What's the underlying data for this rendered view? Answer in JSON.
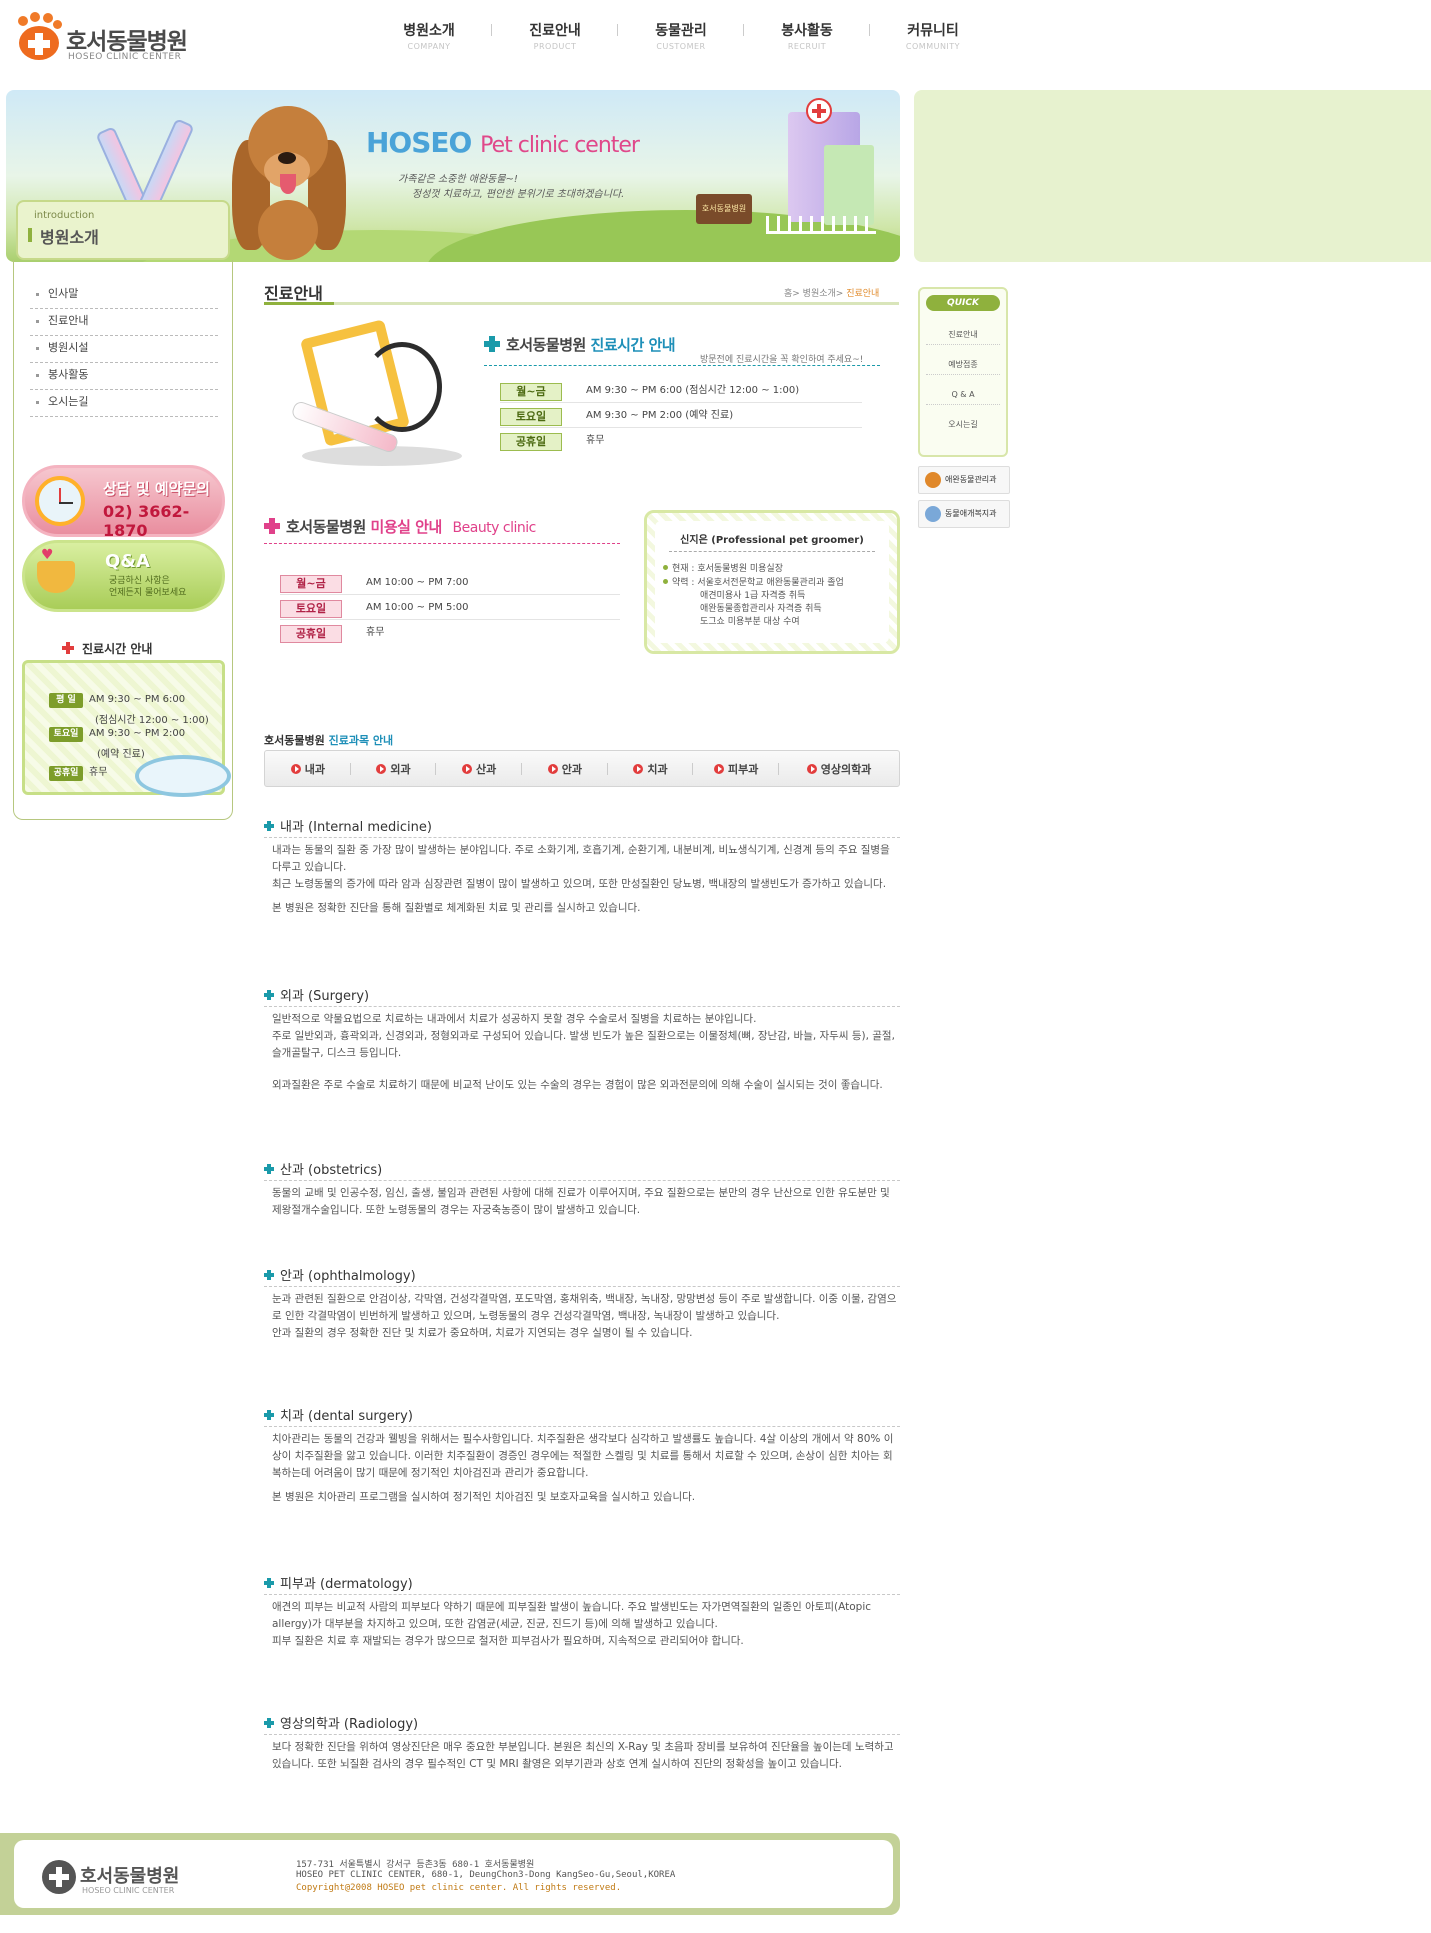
{
  "header": {
    "logo_name": "호서동물병원",
    "logo_sub": "HOSEO CLINIC CENTER",
    "nav": [
      {
        "ko": "병원소개",
        "en": "COMPANY"
      },
      {
        "ko": "진료안내",
        "en": "PRODUCT"
      },
      {
        "ko": "동물관리",
        "en": "CUSTOMER"
      },
      {
        "ko": "봉사활동",
        "en": "RECRUIT"
      },
      {
        "ko": "커뮤니티",
        "en": "COMMUNITY"
      }
    ]
  },
  "banner": {
    "title_a": "HOSEO",
    "title_b": "Pet clinic center",
    "copy1": "가족같은 소중한 애완동물~!",
    "copy2": "정성껏 치료하고, 편안한 분위기로 초대하겠습니다.",
    "sign": "호서동물병원"
  },
  "sidebar": {
    "title_en": "introduction",
    "title_ko": "병원소개",
    "items": [
      "인사말",
      "진료안내",
      "병원시설",
      "봉사활동",
      "오시는길"
    ],
    "counsel_title": "상담 및 예약문의",
    "counsel_phone": "02) 3662-1870",
    "qa_title": "Q&A",
    "qa_sub1": "궁금하신 사항은",
    "qa_sub2": "언제든지 물어보세요",
    "hours_title": "진료시간 안내",
    "hours": [
      {
        "tag": "평 일",
        "text": "AM 9:30 ~ PM 6:00",
        "sub": "(점심시간 12:00 ~ 1:00)"
      },
      {
        "tag": "토요일",
        "text": "AM 9:30 ~ PM 2:00",
        "sub": "(예약 진료)"
      },
      {
        "tag": "공휴일",
        "text": "휴무",
        "sub": ""
      }
    ]
  },
  "main": {
    "page_title": "진료안내",
    "breadcrumb_a": "홈> 병원소개> ",
    "breadcrumb_cur": "진료안내",
    "clinic_hours": {
      "title_a": "호서동물병원",
      "title_b": "진료시간 안내",
      "note": "방문전에 진료시간을 꼭 확인하여 주세요~!",
      "rows": [
        {
          "tag": "월~금",
          "value": "AM 9:30 ~ PM 6:00 (점심시간 12:00 ~ 1:00)"
        },
        {
          "tag": "토요일",
          "value": "AM 9:30 ~ PM 2:00 (예약 진료)"
        },
        {
          "tag": "공휴일",
          "value": "휴무"
        }
      ]
    },
    "beauty": {
      "title_a": "호서동물병원",
      "title_b": "미용실 안내",
      "title_c": "Beauty clinic",
      "rows": [
        {
          "tag": "월~금",
          "value": "AM 10:00 ~ PM 7:00"
        },
        {
          "tag": "토요일",
          "value": "AM 10:00 ~ PM 5:00"
        },
        {
          "tag": "공휴일",
          "value": "휴무"
        }
      ]
    },
    "groomer": {
      "name": "신지은 (Professional pet groomer)",
      "current": "현재 : 호서동물병원 미용실장",
      "career1": "약력 : 서울호서전문학교 애완동물관리과 졸업",
      "career2": "애견미용사 1급 자격증 취득",
      "career3": "애완동물종합관리사 자격증 취득",
      "career4": "도그쇼 미용부분 대상 수여"
    },
    "dept_title_a": "호서동물병원",
    "dept_title_b": "진료과목 안내",
    "dept_tabs": [
      "내과",
      "외과",
      "산과",
      "안과",
      "치과",
      "피부과",
      "영상의학과"
    ],
    "departments": [
      {
        "title": "내과 (Internal medicine)",
        "paragraphs": [
          "내과는 동물의 질환 중 가장 많이 발생하는 분야입니다. 주로 소화기계, 호흡기계, 순환기계, 내분비계, 비뇨생식기계, 신경계 등의 주요 질병을 다루고 있습니다.",
          "최근 노령동물의 증가에 따라 암과 심장관련 질병이 많이 발생하고 있으며, 또한 만성질환인 당뇨병, 백내장의 발생빈도가 증가하고 있습니다.",
          "본 병원은 정확한 진단을 통해 질환별로 체계화된 치료 및 관리를 실시하고 있습니다."
        ]
      },
      {
        "title": "외과 (Surgery)",
        "paragraphs": [
          "일반적으로 약물요법으로 치료하는 내과에서 치료가 성공하지 못할 경우 수술로서 질병을 치료하는 분야입니다.",
          "주로 일반외과, 흉곽외과, 신경외과, 정형외과로 구성되어 있습니다. 발생 빈도가 높은 질환으로는 이물정체(뼈, 장난감, 바늘, 자두씨 등), 골절, 슬개골탈구, 디스크 등입니다.",
          "외과질환은 주로 수술로 치료하기 때문에 비교적 난이도 있는 수술의 경우는 경험이 많은 외과전문의에 의해 수술이 실시되는 것이 좋습니다."
        ]
      },
      {
        "title": "산과 (obstetrics)",
        "paragraphs": [
          "동물의 교배 및 인공수정, 임신, 출생, 불임과 관련된 사항에 대해 진료가 이루어지며, 주요 질환으로는 분만의 경우 난산으로 인한 유도분만 및 제왕절개수술입니다. 또한 노령동물의 경우는 자궁축농증이 많이 발생하고 있습니다."
        ]
      },
      {
        "title": "안과 (ophthalmology)",
        "paragraphs": [
          "눈과 관련된 질환으로 안검이상, 각막염, 건성각결막염, 포도막염, 홍채위축, 백내장, 녹내장, 망망변성 등이 주로 발생합니다. 이중 이물, 감염으로 인한 각결막염이 빈번하게 발생하고 있으며, 노령동물의 경우 건성각결막염, 백내장, 녹내장이 발생하고 있습니다.",
          "안과 질환의 경우 정확한 진단 및 치료가 중요하며, 치료가 지연되는 경우 실명이 될 수 있습니다."
        ]
      },
      {
        "title": "치과 (dental surgery)",
        "paragraphs": [
          "치아관리는 동물의 건강과 웰빙을 위해서는 필수사항입니다. 치주질환은 생각보다 심각하고 발생률도 높습니다. 4살 이상의 개에서 약 80% 이상이 치주질환을 앓고 있습니다. 이러한 치주질환이 경증인 경우에는 적절한 스켈링 및 치료를 통해서 치료할 수 있으며, 손상이 심한 치아는 회복하는데 어려움이 많기 때문에 정기적인 치아검진과 관리가 중요합니다.",
          "본 병원은 치아관리 프로그램을 실시하여 정기적인 치아검진 및 보호자교육을 실시하고 있습니다."
        ]
      },
      {
        "title": "피부과 (dermatology)",
        "paragraphs": [
          "애견의 피부는 비교적 사람의 피부보다 약하기 때문에 피부질환 발생이 높습니다. 주요 발생빈도는 자가면역질환의 일종인 아토피(Atopic allergy)가 대부분을 차지하고 있으며, 또한 감염균(세균, 진균, 진드기 등)에 의해 발생하고 있습니다.",
          "피부 질환은 치료 후 재발되는 경우가 많으므로 철저한 피부검사가 필요하며, 지속적으로 관리되어야 합니다."
        ]
      },
      {
        "title": "영상의학과 (Radiology)",
        "paragraphs": [
          "보다 정확한 진단을 위하여 영상진단은 매우 중요한 부분입니다. 본원은 최신의 X-Ray 및 초음파 장비를 보유하여 진단율을 높이는데 노력하고 있습니다. 또한 뇌질환 검사의 경우 필수적인 CT 및 MRI 촬영은 외부기관과 상호 연계 실시하여 진단의 정확성을 높이고 있습니다."
        ]
      }
    ]
  },
  "quick": {
    "head": "QUICK",
    "items": [
      "진료안내",
      "예방접종",
      "Q & A",
      "오시는길"
    ],
    "banner1": "애완동물관리과",
    "banner2": "동물애개복지과"
  },
  "footer": {
    "logo_name": "호서동물병원",
    "logo_sub": "HOSEO CLINIC CENTER",
    "addr_ko": "157-731 서울특별시 강서구 등촌3동 680-1 호서동물병원",
    "addr_en": "HOSEO PET CLINIC CENTER, 680-1, DeungChon3-Dong KangSeo-Gu,Seoul,KOREA",
    "copyright": "Copyright@2008 HOSEO pet clinic center. All rights reserved."
  },
  "colors": {
    "accent_green": "#8fb13d",
    "accent_teal": "#1a9aaa",
    "accent_pink": "#e0418a",
    "brand_orange": "#ee6b1f"
  }
}
